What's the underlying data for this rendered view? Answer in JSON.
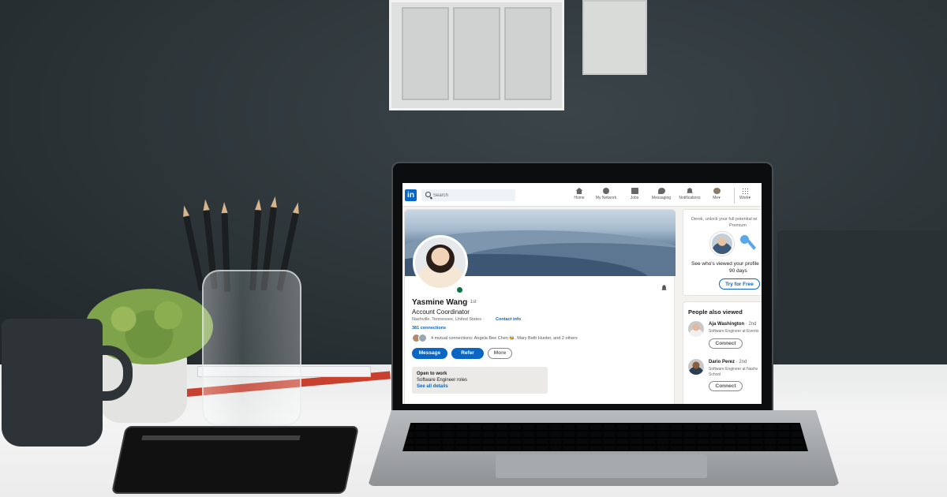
{
  "nav": {
    "logo": "in",
    "search_placeholder": "Search",
    "items": [
      {
        "label": "Home",
        "icon": "home-icon"
      },
      {
        "label": "My Network",
        "icon": "network-icon"
      },
      {
        "label": "Jobs",
        "icon": "briefcase-icon"
      },
      {
        "label": "Messaging",
        "icon": "messaging-icon"
      },
      {
        "label": "Notifications",
        "icon": "bell-icon"
      },
      {
        "label": "Me",
        "icon": "avatar-icon"
      },
      {
        "label": "Work",
        "icon": "grid-icon"
      }
    ]
  },
  "profile": {
    "name": "Yasmine Wang",
    "degree": "· 1st",
    "headline": "Account Coordinator",
    "location": "Nashville, Tennessee, United States ·",
    "contact_info": "Contact info",
    "connections": "381 connections",
    "mutual": "4 mutual connections: Angela Bee Chen 🐝, Mary Beth Hunter, and 2 others",
    "buttons": {
      "message": "Message",
      "refer": "Refer",
      "more": "More"
    },
    "open_to_work": {
      "title": "Open to work",
      "roles": "Software Engineer roles",
      "link": "See all details"
    }
  },
  "premium": {
    "line1": "Derek, unlock your full potential wi",
    "line2": "Premium",
    "main": "See who's viewed your profile",
    "sub": "90 days",
    "button": "Try for Free"
  },
  "people_also_viewed": {
    "title": "People also viewed",
    "people": [
      {
        "name": "Aja Washington",
        "degree": "· 2nd",
        "subtitle": "Software Engineer at Events",
        "button": "Connect"
      },
      {
        "name": "Dario Perez",
        "degree": "· 2nd",
        "subtitle": "Software Engineer at Nashv",
        "subtitle2": "School",
        "button": "Connect"
      }
    ]
  },
  "colors": {
    "brand": "#0a66c2",
    "open_badge": "#057642"
  }
}
